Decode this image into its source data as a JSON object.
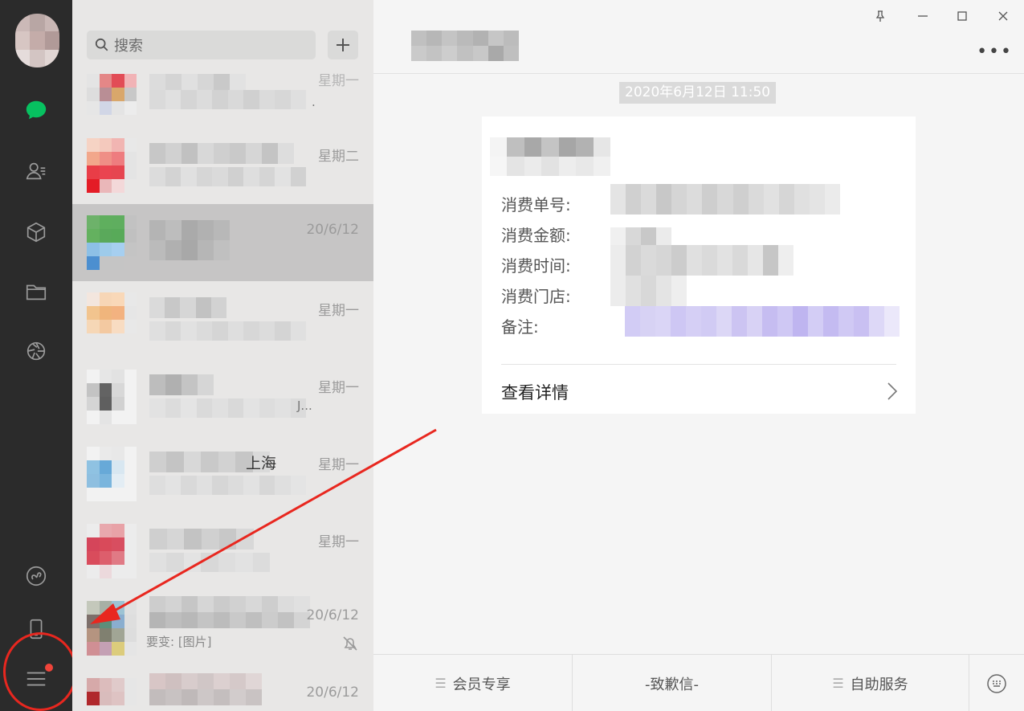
{
  "search": {
    "placeholder": "搜索"
  },
  "chats": [
    {
      "time": "星期一",
      "trail": "."
    },
    {
      "time": "星期二"
    },
    {
      "time": "20/6/12"
    },
    {
      "time": "星期一"
    },
    {
      "time": "星期一",
      "trail": "J..."
    },
    {
      "time": "星期一",
      "trail": "上海"
    },
    {
      "time": "星期一"
    },
    {
      "time": "20/6/12",
      "snippet": "要变: [图片]"
    },
    {
      "time": "20/6/12"
    }
  ],
  "conversation": {
    "timestamp": "2020年6月12日 11:50",
    "card": {
      "fields": [
        "消费单号:",
        "消费金额:",
        "消费时间:",
        "消费门店:",
        "备注:"
      ],
      "details_label": "查看详情"
    },
    "bottom_menu": {
      "members": "会员专享",
      "apology": "-致歉信-",
      "self_service": "自助服务"
    },
    "more_label": "•••"
  },
  "colors": {
    "sidebar": "#2b2b2b",
    "wechat_green": "#07c160",
    "annotation_red": "#e8271f"
  }
}
